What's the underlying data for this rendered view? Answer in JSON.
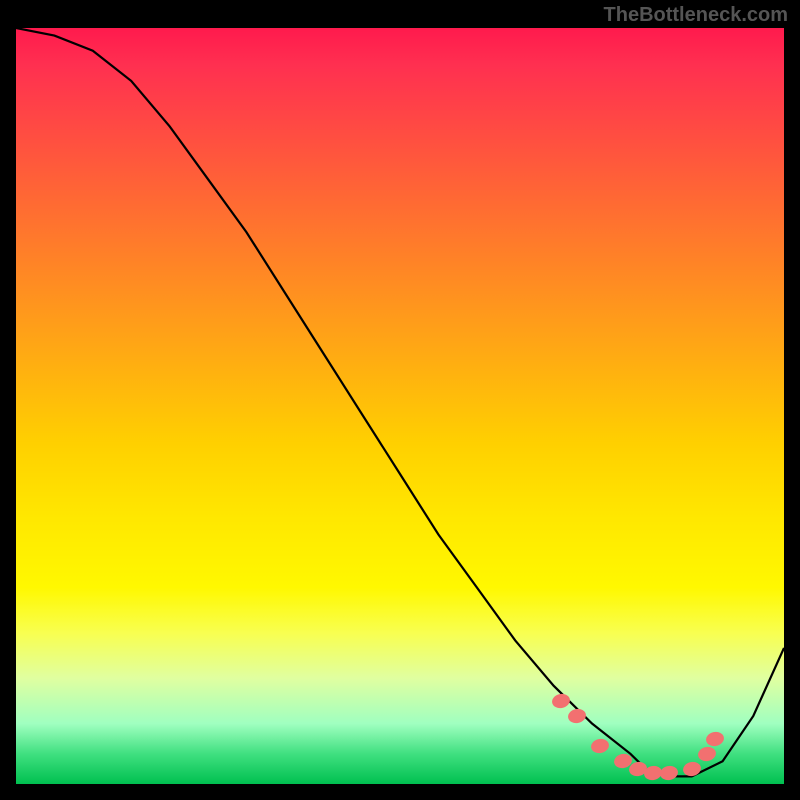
{
  "watermark": "TheBottleneck.com",
  "chart_data": {
    "type": "line",
    "title": "",
    "xlabel": "",
    "ylabel": "",
    "xlim": [
      0,
      100
    ],
    "ylim": [
      0,
      100
    ],
    "grid": false,
    "series": [
      {
        "name": "curve",
        "x": [
          0,
          5,
          10,
          15,
          20,
          25,
          30,
          35,
          40,
          45,
          50,
          55,
          60,
          65,
          70,
          75,
          80,
          82,
          85,
          88,
          92,
          96,
          100
        ],
        "y": [
          100,
          99,
          97,
          93,
          87,
          80,
          73,
          65,
          57,
          49,
          41,
          33,
          26,
          19,
          13,
          8,
          4,
          2,
          1,
          1,
          3,
          9,
          18
        ]
      },
      {
        "name": "dots",
        "x": [
          71,
          73,
          76,
          79,
          81,
          83,
          85,
          88,
          90,
          91
        ],
        "y": [
          11,
          9,
          5,
          3,
          2,
          1.5,
          1.5,
          2,
          4,
          6
        ]
      }
    ]
  }
}
